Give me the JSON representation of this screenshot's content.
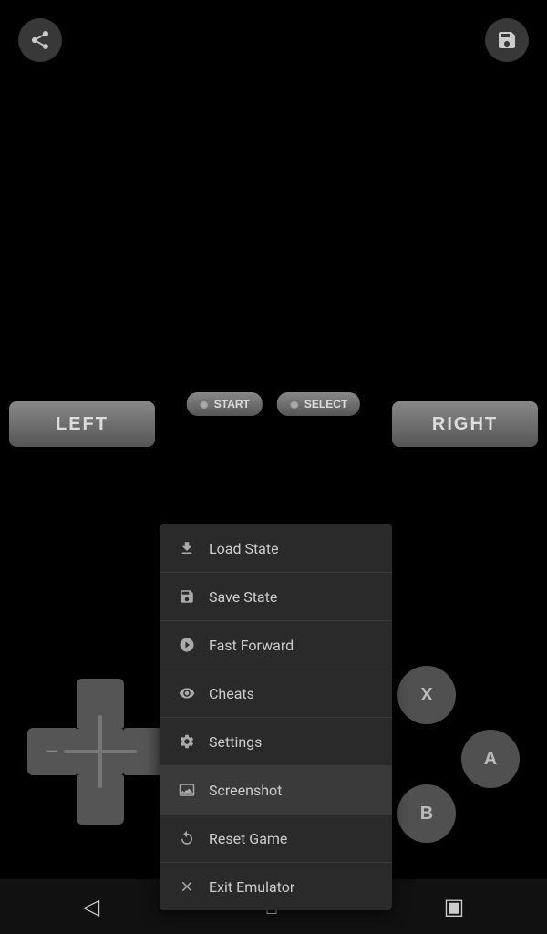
{
  "topBar": {
    "shareIconLabel": "share",
    "saveIconLabel": "save"
  },
  "gameControls": {
    "startLabel": "START",
    "selectLabel": "SELECT",
    "leftLabel": "LEFT",
    "rightLabel": "RIGHT"
  },
  "actionButtons": {
    "x": "X",
    "a": "A",
    "b": "B"
  },
  "menu": {
    "items": [
      {
        "id": "load-state",
        "label": "Load State",
        "icon": "📤"
      },
      {
        "id": "save-state",
        "label": "Save State",
        "icon": "💾"
      },
      {
        "id": "fast-forward",
        "label": "Fast Forward",
        "icon": "⏱"
      },
      {
        "id": "cheats",
        "label": "Cheats",
        "icon": "👁"
      },
      {
        "id": "settings",
        "label": "Settings",
        "icon": "🔧"
      },
      {
        "id": "screenshot",
        "label": "Screenshot",
        "icon": "🖼"
      },
      {
        "id": "reset-game",
        "label": "Reset Game",
        "icon": "↩"
      },
      {
        "id": "exit-emulator",
        "label": "Exit Emulator",
        "icon": "✕"
      }
    ]
  },
  "bottomNav": {
    "backIcon": "◁",
    "homeIcon": "⌂",
    "recentIcon": "▣"
  }
}
